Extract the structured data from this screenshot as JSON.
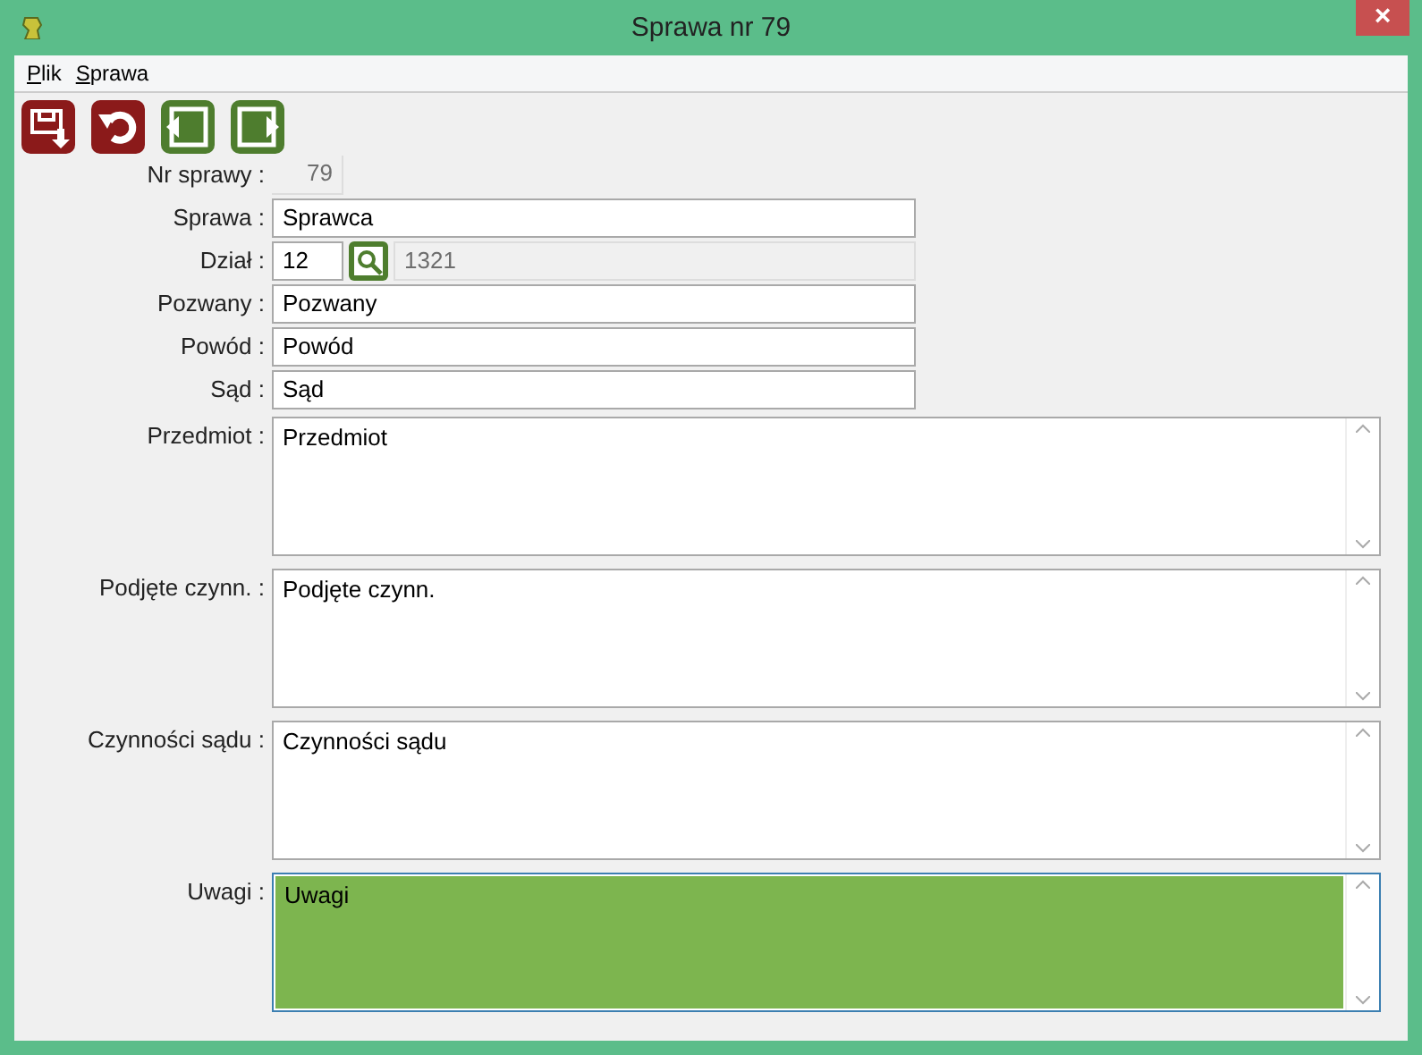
{
  "window": {
    "title": "Sprawa nr 79",
    "close": "×"
  },
  "menu": [
    {
      "label": "Plik"
    },
    {
      "label": "Sprawa"
    }
  ],
  "toolbar": [
    {
      "kind": "save"
    },
    {
      "kind": "undo"
    },
    {
      "kind": "prev"
    },
    {
      "kind": "next"
    }
  ],
  "fields": [
    {
      "kind": "readonly",
      "label": "Nr sprawy :",
      "value": "79"
    },
    {
      "kind": "text",
      "label": "Sprawa :",
      "value": "Sprawca"
    },
    {
      "kind": "lookup",
      "label": "Dział :",
      "value": "12",
      "lookup_value": "1321"
    },
    {
      "kind": "text",
      "label": "Pozwany :",
      "value": "Pozwany"
    },
    {
      "kind": "text",
      "label": "Powód :",
      "value": "Powód"
    },
    {
      "kind": "text",
      "label": "Sąd :",
      "value": "Sąd"
    },
    {
      "kind": "textarea",
      "label": "Przedmiot :",
      "value": "Przedmiot",
      "focused": false
    },
    {
      "kind": "textarea",
      "label": "Podjęte czynn. :",
      "value": "Podjęte czynn.",
      "focused": false
    },
    {
      "kind": "textarea",
      "label": "Czynności sądu :",
      "value": "Czynności sądu",
      "focused": false
    },
    {
      "kind": "textarea",
      "label": "Uwagi :",
      "value": "Uwagi",
      "focused": true
    }
  ]
}
